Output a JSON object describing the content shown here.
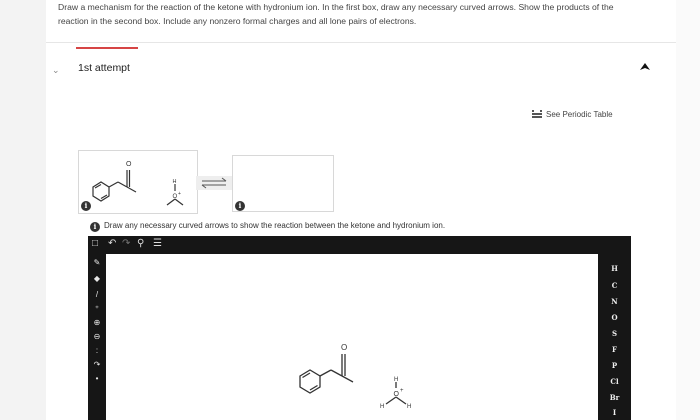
{
  "question": {
    "line1": "Draw a mechanism for the reaction of the ketone with hydronium ion. In the first box, draw any necessary curved arrows. Show the products of the",
    "line2": "reaction in the second box. Include any nonzero formal charges and all lone pairs of electrons."
  },
  "attempt": {
    "label": "1st attempt"
  },
  "periodic_table": {
    "label": "See Periodic Table"
  },
  "hint": {
    "text": "Draw any necessary curved arrows to show the reaction between the ketone and hydronium ion."
  },
  "info_badge": "i",
  "toolbar": {
    "icons": [
      "square-icon",
      "undo-icon",
      "redo-icon",
      "zoom-icon",
      "template-icon"
    ]
  },
  "tools": {
    "icons": [
      "pencil-icon",
      "eraser-icon",
      "bond-icon",
      "charge-icon",
      "positive-charge-icon",
      "negative-charge-icon",
      "lone-pair-icon",
      "curved-arrow-icon",
      "radical-icon"
    ]
  },
  "elements": [
    "H",
    "C",
    "N",
    "O",
    "S",
    "F",
    "P",
    "Cl",
    "Br",
    "I"
  ],
  "molecules": {
    "hydronium_H": "H",
    "hydronium_O": "O",
    "hydronium_plus": "+",
    "ketone_O": "O"
  }
}
